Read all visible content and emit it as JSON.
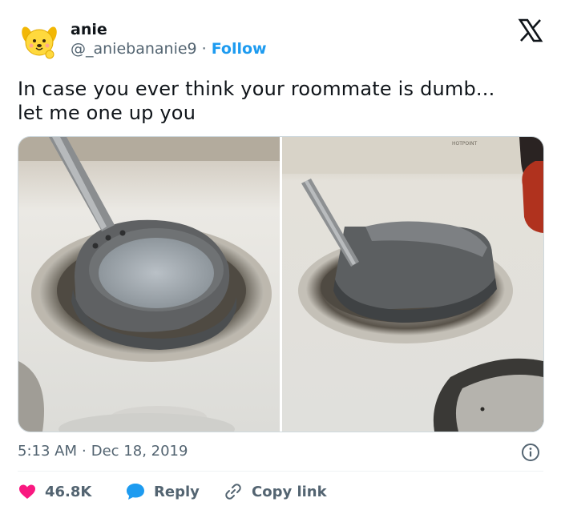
{
  "tweet": {
    "display_name": "anie",
    "handle": "@_aniebananie9",
    "separator": "·",
    "follow_label": "Follow",
    "text_line1": "In case you ever think your roommate is dumb...",
    "text_line2": "let me one up you",
    "time": "5:13 AM",
    "date_separator": "·",
    "date": "Dec 18, 2019",
    "stove_brand": "HOTPOINT"
  },
  "actions": {
    "like_count": "46.8K",
    "reply_label": "Reply",
    "copy_label": "Copy link"
  },
  "colors": {
    "accent": "#1d9bf0",
    "like": "#f91880",
    "text": "#0f1419",
    "muted": "#536471"
  },
  "icons": {
    "avatar": "yellow-dog-avatar",
    "brand": "x-logo-icon",
    "info": "info-icon",
    "like": "heart-icon",
    "reply": "speech-bubble-icon",
    "copy": "link-icon"
  }
}
